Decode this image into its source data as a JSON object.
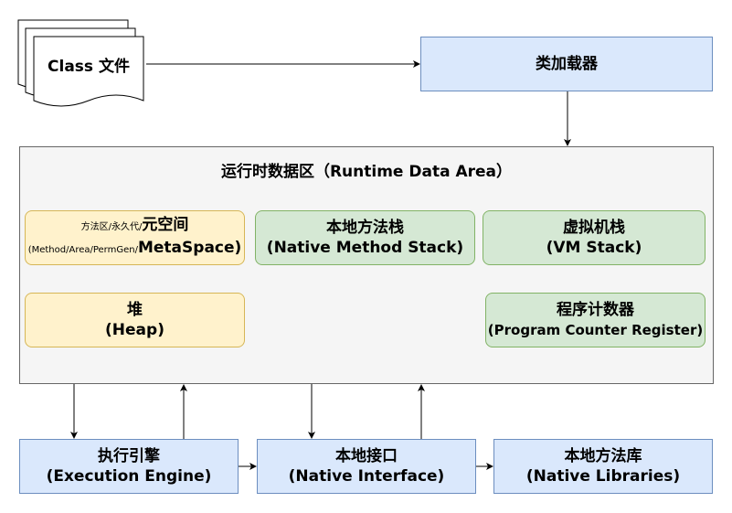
{
  "class_file": {
    "label": "Class 文件"
  },
  "class_loader": {
    "label": "类加载器"
  },
  "runtime_area": {
    "title": "运行时数据区（Runtime Data Area）"
  },
  "metaspace": {
    "small_label": "方法区/永久代/",
    "label_cn": "元空间",
    "small_label2": "(Method/Area/PermGen/",
    "label_en": "MetaSpace)"
  },
  "native_method_stack": {
    "label_cn": "本地方法栈",
    "label_en": "(Native Method Stack)"
  },
  "vm_stack": {
    "label_cn": "虚拟机栈",
    "label_en": "(VM Stack)"
  },
  "heap": {
    "label_cn": "堆",
    "label_en": "(Heap)"
  },
  "program_counter": {
    "label_cn": "程序计数器",
    "label_en": "(Program Counter Register)"
  },
  "execution_engine": {
    "label_cn": "执行引擎",
    "label_en": "(Execution Engine)"
  },
  "native_interface": {
    "label_cn": "本地接口",
    "label_en": "(Native Interface)"
  },
  "native_libraries": {
    "label_cn": "本地方法库",
    "label_en": "(Native Libraries)"
  },
  "colors": {
    "blue_fill": "#dae8fc",
    "blue_stroke": "#6c8ebf",
    "green_fill": "#d5e8d4",
    "green_stroke": "#82b366",
    "yellow_fill": "#fff2cc",
    "yellow_stroke": "#d6b656",
    "gray_fill": "#f5f5f5"
  }
}
